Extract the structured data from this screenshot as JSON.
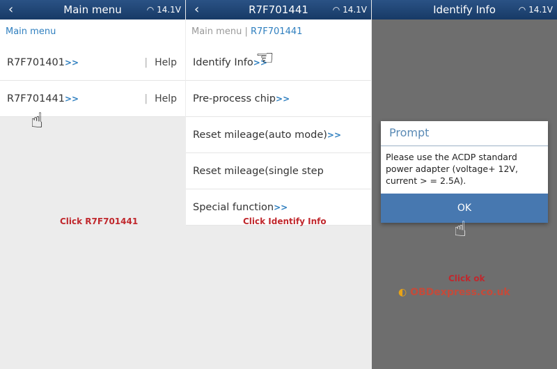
{
  "panels": [
    {
      "header": {
        "title": "Main menu",
        "status": "14.1V"
      },
      "breadcrumb": [
        "Main menu"
      ],
      "rows": [
        {
          "label": "R7F701401",
          "arrow": ">>",
          "help": "Help"
        },
        {
          "label": "R7F701441",
          "arrow": ">>",
          "help": "Help"
        }
      ],
      "caption": "Click R7F701441"
    },
    {
      "header": {
        "title": "R7F701441",
        "status": "14.1V"
      },
      "breadcrumb": [
        "Main menu",
        "R7F701441"
      ],
      "rows": [
        {
          "label": "Identify Info",
          "arrow": ">>"
        },
        {
          "label": "Pre-process chip",
          "arrow": ">>"
        },
        {
          "label": "Reset mileage(auto mode)",
          "arrow": ">>"
        },
        {
          "label": "Reset mileage(single step mode)",
          "arrow": ">>"
        },
        {
          "label": "Special function",
          "arrow": ">>"
        }
      ],
      "caption": "Click Identify Info"
    },
    {
      "header": {
        "title": "Identify Info",
        "status": "14.1V"
      },
      "dialog": {
        "title": "Prompt",
        "message": "Please use the ACDP standard power adapter (voltage+ 12V, current > = 2.5A).",
        "ok": "OK"
      },
      "caption": "Click ok",
      "watermark": "OBDexpress.co.uk"
    }
  ],
  "icons": {
    "back": "chevron-left-icon",
    "wifi": "wifi-icon",
    "hand": "pointing-hand-icon"
  }
}
